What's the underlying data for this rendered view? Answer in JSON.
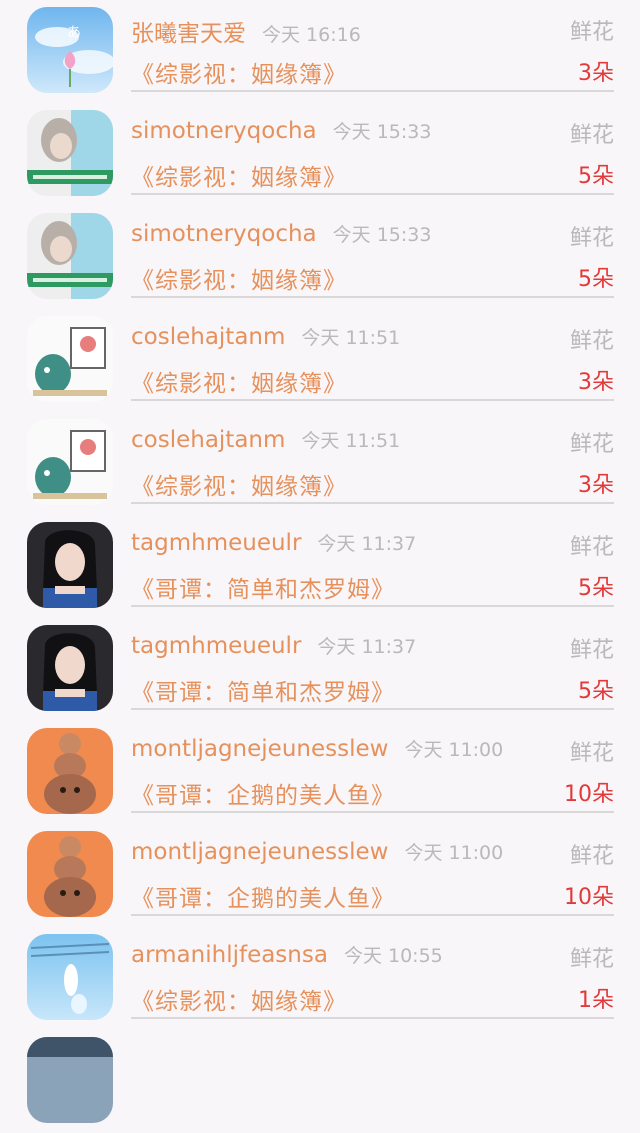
{
  "messages": [
    {
      "username": "张曦害天爱",
      "time": "今天 16:16",
      "gift_label": "鲜花",
      "book_title": "《综影视：姻缘簿》",
      "count": "3朵",
      "avatar": "lotus-sky"
    },
    {
      "username": "simotneryqocha",
      "time": "今天 15:33",
      "gift_label": "鲜花",
      "book_title": "《综影视：姻缘簿》",
      "count": "5朵",
      "avatar": "girl-caption"
    },
    {
      "username": "simotneryqocha",
      "time": "今天 15:33",
      "gift_label": "鲜花",
      "book_title": "《综影视：姻缘簿》",
      "count": "5朵",
      "avatar": "girl-caption"
    },
    {
      "username": "coslehajtanm",
      "time": "今天 11:51",
      "gift_label": "鲜花",
      "book_title": "《综影视：姻缘簿》",
      "count": "3朵",
      "avatar": "cartoon-dino"
    },
    {
      "username": "coslehajtanm",
      "time": "今天 11:51",
      "gift_label": "鲜花",
      "book_title": "《综影视：姻缘簿》",
      "count": "3朵",
      "avatar": "cartoon-dino"
    },
    {
      "username": "tagmhmeueulr",
      "time": "今天 11:37",
      "gift_label": "鲜花",
      "book_title": "《哥谭：简单和杰罗姆》",
      "count": "5朵",
      "avatar": "woman-portrait"
    },
    {
      "username": "tagmhmeueulr",
      "time": "今天 11:37",
      "gift_label": "鲜花",
      "book_title": "《哥谭：简单和杰罗姆》",
      "count": "5朵",
      "avatar": "woman-portrait"
    },
    {
      "username": "montljagnejeunesslew",
      "time": "今天 11:00",
      "gift_label": "鲜花",
      "book_title": "《哥谭：企鹅的美人鱼》",
      "count": "10朵",
      "avatar": "cartoon-stack"
    },
    {
      "username": "montljagnejeunesslew",
      "time": "今天 11:00",
      "gift_label": "鲜花",
      "book_title": "《哥谭：企鹅的美人鱼》",
      "count": "10朵",
      "avatar": "cartoon-stack"
    },
    {
      "username": "armanihljfeasnsa",
      "time": "今天 10:55",
      "gift_label": "鲜花",
      "book_title": "《综影视：姻缘簿》",
      "count": "1朵",
      "avatar": "blue-figure"
    }
  ],
  "colors": {
    "username": "#e6915c",
    "time": "#b9b9b9",
    "count": "#e23a3a",
    "background": "#f8f6f8"
  }
}
